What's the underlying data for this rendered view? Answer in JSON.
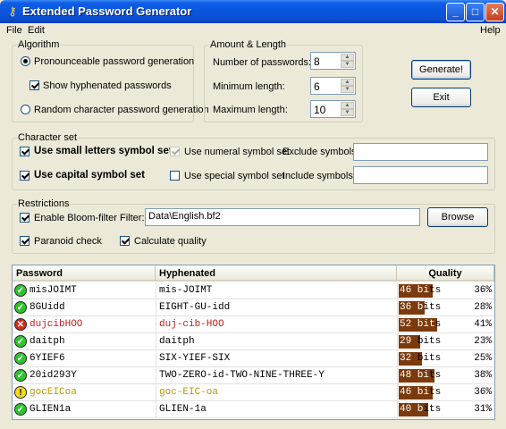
{
  "window": {
    "title": "Extended Password Generator",
    "minimize": "_",
    "maximize": "□",
    "close": "✕"
  },
  "menu": {
    "file": "File",
    "edit": "Edit",
    "help": "Help"
  },
  "algorithm": {
    "legend": "Algorithm",
    "pronounceable": "Pronounceable password generation",
    "show_hyphenated": "Show hyphenated passwords",
    "random": "Random character password generation"
  },
  "amount": {
    "legend": "Amount & Length",
    "num_label": "Number of passwords:",
    "num_value": "8",
    "min_label": "Minimum length:",
    "min_value": "6",
    "max_label": "Maximum length:",
    "max_value": "10"
  },
  "buttons": {
    "generate": "Generate!",
    "exit": "Exit",
    "browse": "Browse"
  },
  "charset": {
    "legend": "Character set",
    "small": "Use small letters symbol set",
    "capital": "Use capital symbol set",
    "numeral": "Use numeral symbol set",
    "special": "Use special symbol set",
    "exclude_label": "Exclude symbols:",
    "exclude_value": "",
    "include_label": "Include symbols:",
    "include_value": ""
  },
  "restrictions": {
    "legend": "Restrictions",
    "bloom": "Enable Bloom-filter",
    "filter_label": "Filter:",
    "filter_value": "Data\\English.bf2",
    "paranoid": "Paranoid check",
    "quality": "Calculate quality"
  },
  "list": {
    "headers": {
      "password": "Password",
      "hyphenated": "Hyphenated",
      "quality": "Quality"
    },
    "rows": [
      {
        "status": "ok",
        "password": "misJOIMT",
        "hyphenated": "mis-JOIMT",
        "bits": "46 bits",
        "pct": "36%",
        "q": 0.36
      },
      {
        "status": "ok",
        "password": "8GUidd",
        "hyphenated": "EIGHT-GU-idd",
        "bits": "36 bits",
        "pct": "28%",
        "q": 0.28
      },
      {
        "status": "bad",
        "password": "dujcibHOO",
        "hyphenated": "duj-cib-HOO",
        "bits": "52 bits",
        "pct": "41%",
        "q": 0.41
      },
      {
        "status": "ok",
        "password": "daitph",
        "hyphenated": "daitph",
        "bits": "29 bits",
        "pct": "23%",
        "q": 0.23
      },
      {
        "status": "ok",
        "password": "6YIEF6",
        "hyphenated": "SIX-YIEF-SIX",
        "bits": "32 bits",
        "pct": "25%",
        "q": 0.25
      },
      {
        "status": "ok",
        "password": "20id293Y",
        "hyphenated": "TWO-ZERO-id-TWO-NINE-THREE-Y",
        "bits": "48 bits",
        "pct": "38%",
        "q": 0.38
      },
      {
        "status": "warn",
        "password": "gocEICoa",
        "hyphenated": "goc-EIC-oa",
        "bits": "46 bits",
        "pct": "36%",
        "q": 0.36
      },
      {
        "status": "ok",
        "password": "GLIEN1a",
        "hyphenated": "GLIEN-1a",
        "bits": "40 bits",
        "pct": "31%",
        "q": 0.31
      }
    ]
  },
  "colors": {
    "ok_text": "#000000",
    "bad_text": "#c0201a",
    "warn_text": "#b89a00",
    "quality_bar": "#7a3a0c"
  }
}
